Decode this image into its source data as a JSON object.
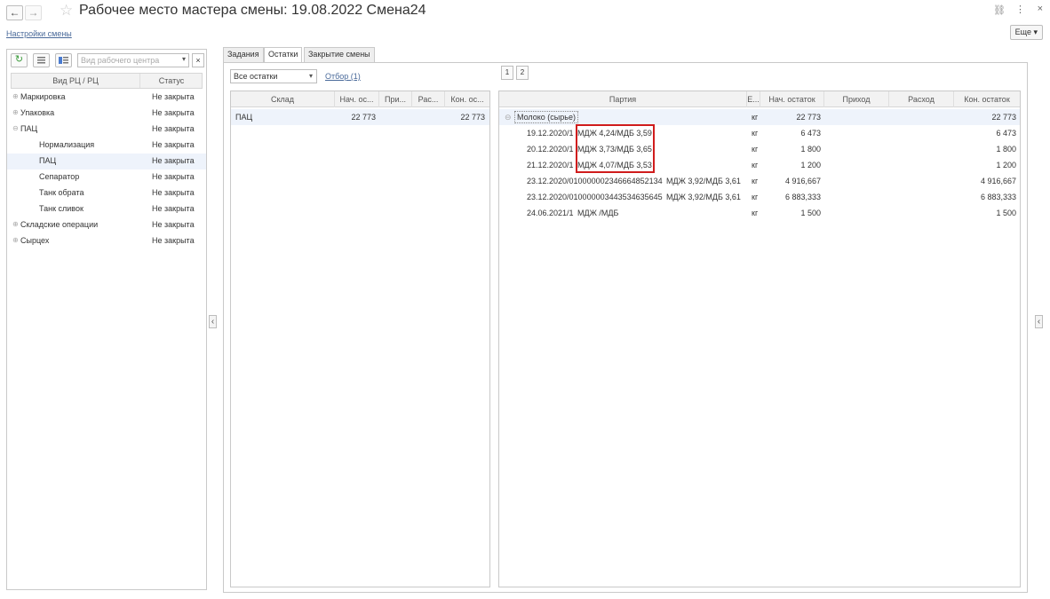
{
  "window": {
    "title": "Рабочее место мастера смены: 19.08.2022 Смена24",
    "settings_link": "Настройки смены",
    "more_button": "Еще"
  },
  "left_panel": {
    "filter_placeholder": "Вид рабочего центра",
    "columns": [
      "Вид РЦ / РЦ",
      "Статус"
    ],
    "rows": [
      {
        "name": "Маркировка",
        "status": "Не закрыта",
        "level": 0,
        "expander": "⊕"
      },
      {
        "name": "Упаковка",
        "status": "Не закрыта",
        "level": 0,
        "expander": "⊕"
      },
      {
        "name": "ПАЦ",
        "status": "Не закрыта",
        "level": 0,
        "expander": "⊖"
      },
      {
        "name": "Нормализация",
        "status": "Не закрыта",
        "level": 1,
        "expander": ""
      },
      {
        "name": "ПАЦ",
        "status": "Не закрыта",
        "level": 1,
        "expander": "",
        "selected": true
      },
      {
        "name": "Сепаратор",
        "status": "Не закрыта",
        "level": 1,
        "expander": ""
      },
      {
        "name": "Танк обрата",
        "status": "Не закрыта",
        "level": 1,
        "expander": ""
      },
      {
        "name": "Танк сливок",
        "status": "Не закрыта",
        "level": 1,
        "expander": ""
      },
      {
        "name": "Складские операции",
        "status": "Не закрыта",
        "level": 0,
        "expander": "⊕"
      },
      {
        "name": "Сырцех",
        "status": "Не закрыта",
        "level": 0,
        "expander": "⊕"
      }
    ]
  },
  "tabs": [
    {
      "label": "Задания",
      "active": false
    },
    {
      "label": "Остатки",
      "active": true
    },
    {
      "label": "Закрытие смены",
      "active": false
    }
  ],
  "filters": {
    "balance_select": "Все остатки",
    "selection_link": "Отбор (1)",
    "pages": [
      "1",
      "2"
    ]
  },
  "warehouse_grid": {
    "columns": [
      "Склад",
      "Нач. ос...",
      "При...",
      "Рас...",
      "Кон. ос..."
    ],
    "rows": [
      {
        "warehouse": "ПАЦ",
        "start": "22 773",
        "in": "",
        "out": "",
        "end": "22 773"
      }
    ]
  },
  "batch_grid": {
    "columns": [
      "Партия",
      "Е...",
      "Нач. остаток",
      "Приход",
      "Расход",
      "Кон. остаток"
    ],
    "group": {
      "name": "Молоко (сырье)",
      "unit": "кг",
      "start": "22 773",
      "in": "",
      "out": "",
      "end": "22 773"
    },
    "rows": [
      {
        "batch": "19.12.2020/1",
        "spec": "МДЖ 4,24/МДБ 3,59",
        "unit": "кг",
        "start": "6 473",
        "in": "",
        "out": "",
        "end": "6 473"
      },
      {
        "batch": "20.12.2020/1",
        "spec": "МДЖ 3,73/МДБ 3,65",
        "unit": "кг",
        "start": "1 800",
        "in": "",
        "out": "",
        "end": "1 800"
      },
      {
        "batch": "21.12.2020/1",
        "spec": "МДЖ 4,07/МДБ 3,53",
        "unit": "кг",
        "start": "1 200",
        "in": "",
        "out": "",
        "end": "1 200"
      },
      {
        "batch": "23.12.2020/010000002346664852134",
        "spec": "МДЖ 3,92/МДБ 3,61",
        "unit": "кг",
        "start": "4 916,667",
        "in": "",
        "out": "",
        "end": "4 916,667"
      },
      {
        "batch": "23.12.2020/010000003443534635645",
        "spec": "МДЖ 3,92/МДБ 3,61",
        "unit": "кг",
        "start": "6 883,333",
        "in": "",
        "out": "",
        "end": "6 883,333"
      },
      {
        "batch": "24.06.2021/1",
        "spec": "МДЖ /МДБ",
        "unit": "кг",
        "start": "1 500",
        "in": "",
        "out": "",
        "end": "1 500"
      }
    ]
  },
  "colors": {
    "highlight_border": "#d01c1c",
    "selected_row": "#eef3fb",
    "link": "#4a6a9a"
  }
}
